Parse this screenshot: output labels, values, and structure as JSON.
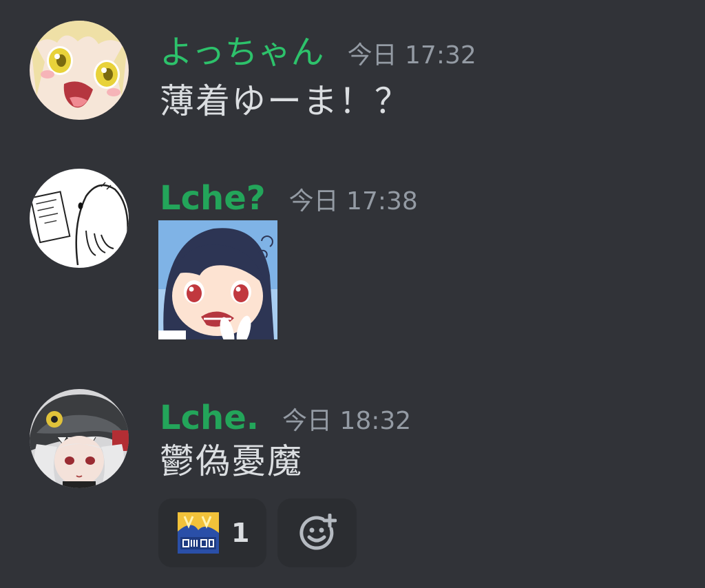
{
  "messages": [
    {
      "username": "よっちゃん",
      "timestamp": "今日 17:32",
      "text": "薄着ゆーま！？",
      "avatar_icon": "anime-girl-avatar-icon",
      "username_color": "#2dc26b"
    },
    {
      "username": "Lche?",
      "timestamp": "今日 17:38",
      "sticker_icon": "anime-girl-sticker-icon",
      "avatar_icon": "ghost-sketch-avatar-icon",
      "username_color": "#23a55a"
    },
    {
      "username": "Lche.",
      "timestamp": "今日 18:32",
      "text": "鬱偽憂魔",
      "avatar_icon": "dinosaur-hood-girl-avatar-icon",
      "username_color": "#23a55a"
    }
  ],
  "reactions": [
    {
      "emoji_icon": "custom-emoji-icon",
      "count": "1"
    }
  ],
  "add_reaction_icon": "add-reaction-icon",
  "colors": {
    "background": "#313338",
    "reaction_bg": "#2b2d31",
    "text": "#dbdee1",
    "muted": "#949ba4"
  }
}
